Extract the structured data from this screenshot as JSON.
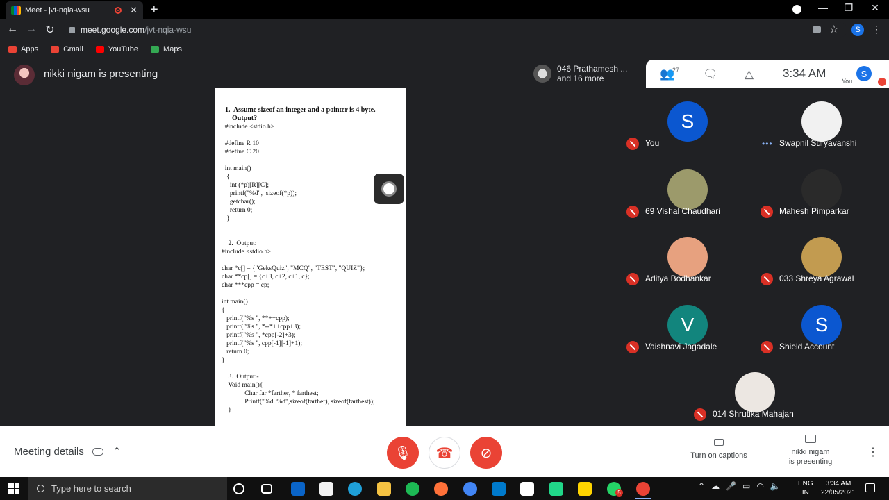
{
  "browser": {
    "tab_title": "Meet - jvt-nqia-wsu",
    "url_host": "meet.google.com",
    "url_path": "/jvt-nqia-wsu",
    "account_initial": "S",
    "bookmarks": [
      {
        "label": "Apps",
        "color": "#ea4335"
      },
      {
        "label": "Gmail",
        "color": "#ea4335"
      },
      {
        "label": "YouTube",
        "color": "#ff0000"
      },
      {
        "label": "Maps",
        "color": "#34a853"
      }
    ]
  },
  "presentation": {
    "title": "nikki nigam is presenting",
    "doc_lines": [
      {
        "text": "  1.  Assume sizeof an integer and a pointer is 4 byte.",
        "bold": true
      },
      {
        "text": "      Output?",
        "bold": true
      },
      {
        "text": "  #include <stdio.h>",
        "bold": false
      },
      {
        "text": "",
        "bold": false
      },
      {
        "text": "  #define R 10",
        "bold": false
      },
      {
        "text": "  #define C 20",
        "bold": false
      },
      {
        "text": "",
        "bold": false
      },
      {
        "text": "  int main()",
        "bold": false
      },
      {
        "text": "   {",
        "bold": false
      },
      {
        "text": "     int (*p)[R][C];",
        "bold": false
      },
      {
        "text": "     printf(\"%d\",  sizeof(*p));",
        "bold": false
      },
      {
        "text": "     getchar();",
        "bold": false
      },
      {
        "text": "     return 0;",
        "bold": false
      },
      {
        "text": "   }",
        "bold": false
      },
      {
        "text": "",
        "bold": false
      },
      {
        "text": "",
        "bold": false
      },
      {
        "text": "    2.  Output:",
        "bold": false
      },
      {
        "text": "#include <stdio.h>",
        "bold": false
      },
      {
        "text": "",
        "bold": false
      },
      {
        "text": "char *c[] = {\"GeksQuiz\", \"MCQ\", \"TEST\", \"QUIZ\"};",
        "bold": false
      },
      {
        "text": "char **cp[] = {c+3, c+2, c+1, c};",
        "bold": false
      },
      {
        "text": "char ***cpp = cp;",
        "bold": false
      },
      {
        "text": "",
        "bold": false
      },
      {
        "text": "int main()",
        "bold": false
      },
      {
        "text": "{",
        "bold": false
      },
      {
        "text": "   printf(\"%s \", **++cpp);",
        "bold": false
      },
      {
        "text": "   printf(\"%s \", *--*++cpp+3);",
        "bold": false
      },
      {
        "text": "   printf(\"%s \", *cpp[-2]+3);",
        "bold": false
      },
      {
        "text": "   printf(\"%s \", cpp[-1][-1]+1);",
        "bold": false
      },
      {
        "text": "   return 0;",
        "bold": false
      },
      {
        "text": "}",
        "bold": false
      },
      {
        "text": "",
        "bold": false
      },
      {
        "text": "    3.  Output:-",
        "bold": false
      },
      {
        "text": "    Void main(){",
        "bold": false
      },
      {
        "text": "              Char far *farther, * farthest;",
        "bold": false
      },
      {
        "text": "              Printf(\"%d..%d\",sizeof(farther), sizeof(farthest));",
        "bold": false
      },
      {
        "text": "    }",
        "bold": false
      }
    ]
  },
  "popup": {
    "line1": "046 Prathamesh ...",
    "line2": "and 16 more"
  },
  "meet_top": {
    "people_count": "27",
    "time": "3:34 AM",
    "you_label": "You",
    "you_initial": "S"
  },
  "participants": [
    {
      "name": "You",
      "initial": "S",
      "color": "#0b57d0",
      "status": "muted"
    },
    {
      "name": "Swapnil Suryavanshi",
      "initial": "",
      "color": "#f1f1f1",
      "status": "speaking"
    },
    {
      "name": "69 Vishal Chaudhari",
      "initial": "",
      "color": "#9c9a6b",
      "status": "muted"
    },
    {
      "name": "Mahesh Pimparkar",
      "initial": "",
      "color": "#2a2a2a",
      "status": "muted"
    },
    {
      "name": "Aditya Bodhankar",
      "initial": "",
      "color": "#e7a17f",
      "status": "muted"
    },
    {
      "name": "033 Shreya Agrawal",
      "initial": "",
      "color": "#c29b50",
      "status": "muted"
    },
    {
      "name": "Vaishnavi Jagadale",
      "initial": "V",
      "color": "#12857d",
      "status": "muted"
    },
    {
      "name": "Shield Account",
      "initial": "S",
      "color": "#0b57d0",
      "status": "muted"
    },
    {
      "name": "014 Shrutika Mahajan",
      "initial": "",
      "color": "#ece7e2",
      "status": "muted"
    }
  ],
  "bottom": {
    "meeting_details": "Meeting details",
    "captions": "Turn on captions",
    "presenting_line1": "nikki nigam",
    "presenting_line2": "is presenting"
  },
  "taskbar": {
    "search_placeholder": "Type here to search",
    "lang_line1": "ENG",
    "lang_line2": "IN",
    "time": "3:34 AM",
    "date": "22/05/2021",
    "apps": [
      {
        "name": "cortana",
        "color": "#101010"
      },
      {
        "name": "task-view",
        "color": "#101010"
      },
      {
        "name": "mail",
        "color": "#0a64c8"
      },
      {
        "name": "store",
        "color": "#f2f2f2"
      },
      {
        "name": "edge",
        "color": "#1fa0d8"
      },
      {
        "name": "explorer",
        "color": "#f5c242"
      },
      {
        "name": "spotify",
        "color": "#1db954"
      },
      {
        "name": "firefox",
        "color": "#ff7139"
      },
      {
        "name": "chrome",
        "color": "#4285f4"
      },
      {
        "name": "vscode",
        "color": "#007acc"
      },
      {
        "name": "word-viewer",
        "color": "#ffffff"
      },
      {
        "name": "pycharm",
        "color": "#21d789"
      },
      {
        "name": "sticky-notes",
        "color": "#ffd400"
      },
      {
        "name": "whatsapp",
        "color": "#25d366"
      },
      {
        "name": "chrome-active",
        "color": "#ea4335"
      }
    ],
    "whatsapp_badge": "5"
  }
}
